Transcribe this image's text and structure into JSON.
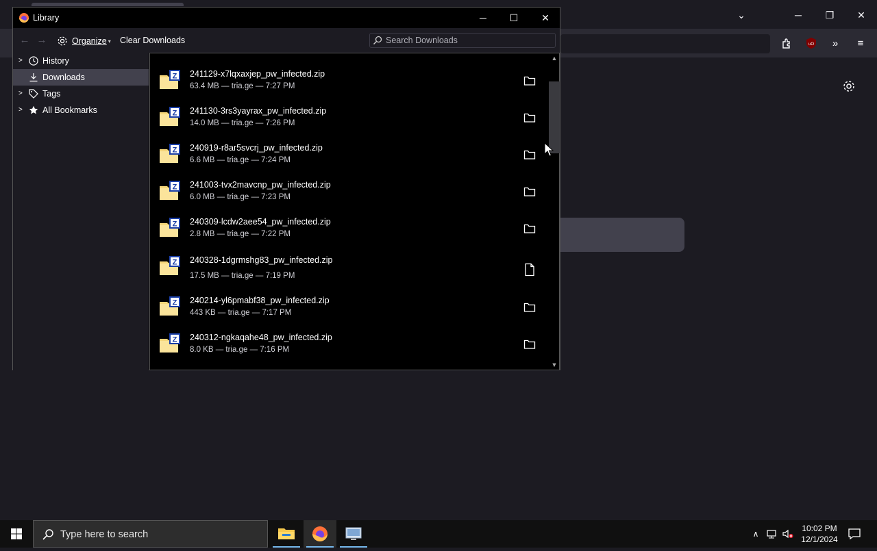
{
  "library": {
    "title": "Library",
    "toolbar": {
      "organize_label": "Organize",
      "clear_downloads_label": "Clear Downloads",
      "search_placeholder": "Search Downloads"
    },
    "sidebar": [
      {
        "label": "History",
        "icon": "clock-icon",
        "expandable": true,
        "selected": false
      },
      {
        "label": "Downloads",
        "icon": "download-icon",
        "expandable": false,
        "selected": true
      },
      {
        "label": "Tags",
        "icon": "tag-icon",
        "expandable": true,
        "selected": false
      },
      {
        "label": "All Bookmarks",
        "icon": "star-icon",
        "expandable": true,
        "selected": false
      }
    ],
    "downloads": [
      {
        "name": "241129-x7lqxaxjep_pw_infected.zip",
        "meta": "63.4 MB — tria.ge — 7:27 PM"
      },
      {
        "name": "241130-3rs3yayrax_pw_infected.zip",
        "meta": "14.0 MB — tria.ge — 7:26 PM"
      },
      {
        "name": "240919-r8ar5svcrj_pw_infected.zip",
        "meta": "6.6 MB — tria.ge — 7:24 PM"
      },
      {
        "name": "241003-tvx2mavcnp_pw_infected.zip",
        "meta": "6.0 MB — tria.ge — 7:23 PM"
      },
      {
        "name": "240309-lcdw2aee54_pw_infected.zip",
        "meta": "2.8 MB — tria.ge — 7:22 PM"
      },
      {
        "name": "240328-1dgrmshg83_pw_infected.zip",
        "meta": "17.5 MB — tria.ge — 7:19 PM"
      },
      {
        "name": "240214-yl6pmabf38_pw_infected.zip",
        "meta": "443 KB — tria.ge — 7:17 PM"
      },
      {
        "name": "240312-ngkaqahe48_pw_infected.zip",
        "meta": "8.0 KB — tria.ge — 7:16 PM"
      }
    ]
  },
  "taskbar": {
    "search_placeholder": "Type here to search",
    "time": "10:02 PM",
    "date": "12/1/2024"
  },
  "colors": {
    "accent": "#76b9ed",
    "selected_row": "#42414d",
    "window_bg": "#1c1b22"
  }
}
